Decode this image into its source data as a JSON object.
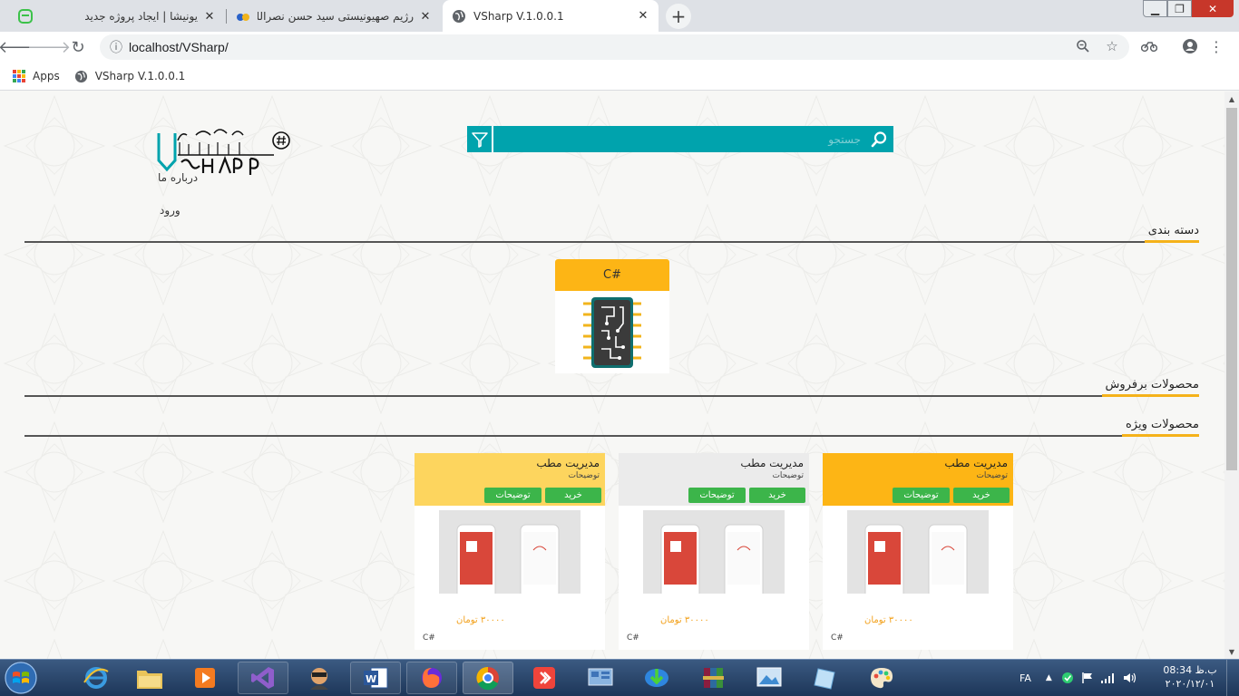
{
  "browser": {
    "tabs": [
      {
        "title": "یونیشا | ایجاد پروژه جدید",
        "active": false
      },
      {
        "title": "رژیم صهیونیستی سید حسن نصرالله را به",
        "active": false
      },
      {
        "title": "VSharp V.1.0.0.1",
        "active": true
      }
    ],
    "url": "localhost/VSharp/",
    "bookmarks": [
      {
        "label": "Apps"
      },
      {
        "label": "VSharp V.1.0.0.1"
      }
    ]
  },
  "page": {
    "logo_text": "VSharp",
    "nav": {
      "about": "درباره ما",
      "login": "ورود"
    },
    "search": {
      "placeholder": "جستجو"
    },
    "sections": {
      "categories": "دسته بندی",
      "bestsellers": "محصولات برفروش",
      "featured": "محصولات ویژه"
    },
    "category": {
      "name": "C#"
    },
    "products": [
      {
        "name": "مدیریت مطب",
        "desc": "توضیحات",
        "buy": "خرید",
        "info": "توضیحات",
        "price": "۳۰۰۰۰ تومان",
        "tag": "C#",
        "header_color": "#fdd55e"
      },
      {
        "name": "مدیریت مطب",
        "desc": "توضیحات",
        "buy": "خرید",
        "info": "توضیحات",
        "price": "۳۰۰۰۰ تومان",
        "tag": "C#",
        "header_color": "#ebebeb"
      },
      {
        "name": "مدیریت مطب",
        "desc": "توضیحات",
        "buy": "خرید",
        "info": "توضیحات",
        "price": "۳۰۰۰۰ تومان",
        "tag": "C#",
        "header_color": "#fdb515"
      }
    ]
  },
  "taskbar": {
    "language": "FA",
    "time": "ب.ظ 08:34",
    "date": "۲۰۲۰/۱۲/۰۱"
  },
  "colors": {
    "accent_teal": "#00a3ad",
    "accent_orange": "#fdb515",
    "button_green": "#3cb54a"
  }
}
